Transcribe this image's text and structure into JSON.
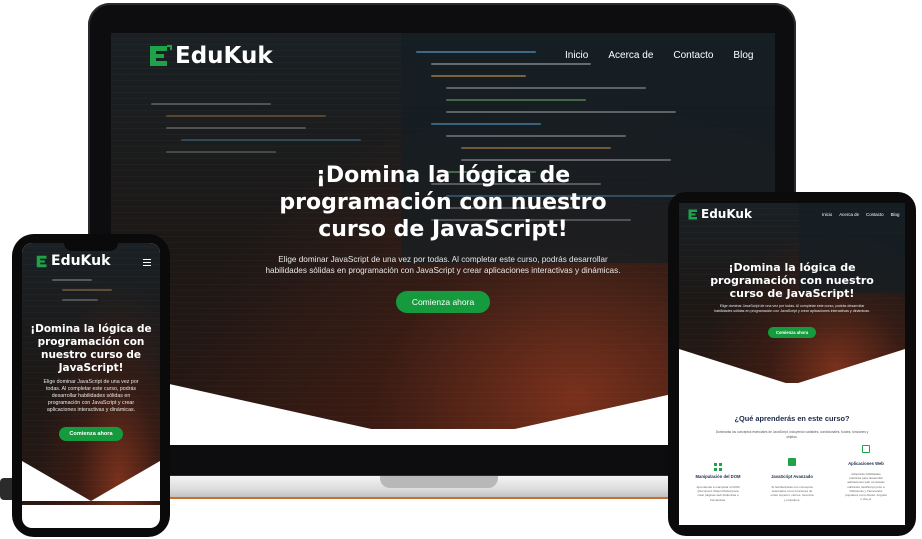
{
  "brand": {
    "name": "EduKuk",
    "accent_color": "#159a3e",
    "logo_icon": "e-bracket-logo-icon"
  },
  "nav": {
    "items": [
      "Inicio",
      "Acerca de",
      "Contacto",
      "Blog"
    ],
    "menu_icon": "hamburger-menu-icon"
  },
  "hero": {
    "title_line1": "¡Domina la lógica de",
    "title_line2": "programación con nuestro",
    "title_line3": "curso de JavaScript!",
    "phone_title_line1": "¡Domina la lógica de",
    "phone_title_line2": "programación con",
    "phone_title_line3": "nuestro curso de",
    "phone_title_line4": "JavaScript!",
    "subtitle_line1": "Elige dominar JavaScript de una vez por todas. Al completar este curso, podrás desarrollar",
    "subtitle_line2": "habilidades sólidas en programación con JavaScript y crear aplicaciones interactivas y dinámicas.",
    "phone_subtitle_line1": "Elige dominar JavaScript de una vez por",
    "phone_subtitle_line2": "todas. Al completar este curso, podrás",
    "phone_subtitle_line3": "desarrollar habilidades sólidas en",
    "phone_subtitle_line4": "programación con JavaScript y crear",
    "phone_subtitle_line5": "aplicaciones interactivas y dinámicas.",
    "cta_label": "Comienza ahora"
  },
  "learn": {
    "heading": "¿Qué aprenderás en este curso?",
    "intro_line1": "Dominarás los conceptos esenciales de JavaScript, incluyendo variables, condicionales, bucles, funciones y",
    "intro_line2": "objetos.",
    "features": [
      {
        "icon": "dom-grid-icon",
        "title": "Manipulación del DOM",
        "line1": "Aprenderás a manipular el DOM",
        "line2": "(Document Object Model) para",
        "line3": "crear páginas web dinámicas e",
        "line4": "interactivas."
      },
      {
        "icon": "js-badge-icon",
        "title": "JavaScript Avanzado",
        "line1": "Te familiarizarás con conceptos",
        "line2": "avanzados como funciones de",
        "line3": "orden superior, cierres, herencia",
        "line4": "y prototipos."
      },
      {
        "icon": "web-app-icon",
        "title": "Aplicaciones Web",
        "line1": "Adquirirás habilidades",
        "line2": "prácticas para desarrollar",
        "line3": "aplicaciones web completas",
        "line4": "utilizando JavaScript junto a",
        "line5": "bibliotecas y frameworks",
        "line6": "populares como React, Angular",
        "line7": "o Vue.js."
      }
    ]
  }
}
